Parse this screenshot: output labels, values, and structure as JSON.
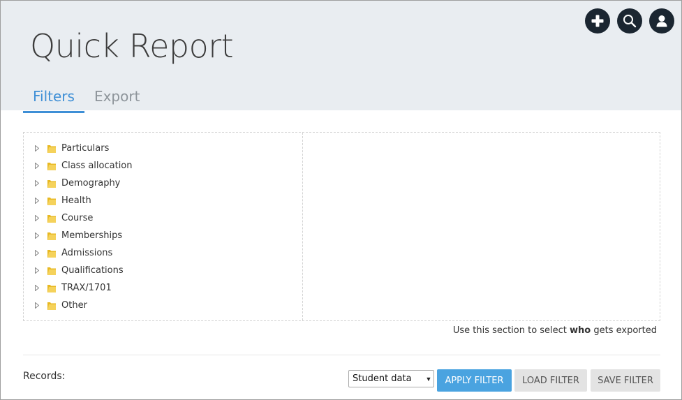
{
  "header": {
    "title": "Quick Report",
    "icons": [
      {
        "name": "add-icon"
      },
      {
        "name": "search-icon"
      },
      {
        "name": "user-icon"
      }
    ]
  },
  "tabs": [
    {
      "label": "Filters",
      "active": true
    },
    {
      "label": "Export",
      "active": false
    }
  ],
  "tree": {
    "items": [
      {
        "label": "Particulars"
      },
      {
        "label": "Class allocation"
      },
      {
        "label": "Demography"
      },
      {
        "label": "Health"
      },
      {
        "label": "Course"
      },
      {
        "label": "Memberships"
      },
      {
        "label": "Admissions"
      },
      {
        "label": "Qualifications"
      },
      {
        "label": "TRAX/1701"
      },
      {
        "label": "Other"
      }
    ]
  },
  "hint": {
    "prefix": "Use this section to select ",
    "emphasis": "who",
    "suffix": " gets exported"
  },
  "footer": {
    "records_label": "Records:",
    "select_value": "Student data",
    "apply_label": "APPLY FILTER",
    "load_label": "LOAD FILTER",
    "save_label": "SAVE FILTER"
  },
  "colors": {
    "header_bg": "#e9edf1",
    "accent": "#3e8fd6",
    "apply_button": "#4aa3e0",
    "icon_button": "#1b2631",
    "folder": "#e8b923"
  }
}
